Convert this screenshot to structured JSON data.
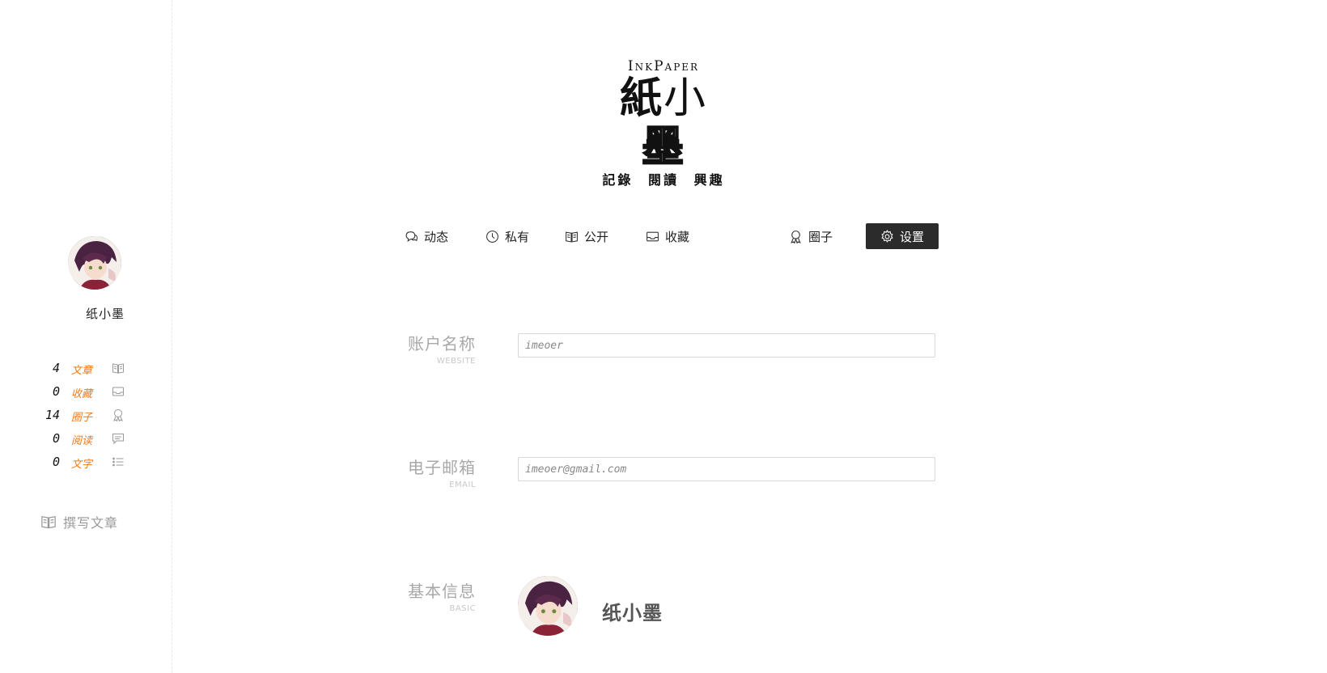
{
  "logo": {
    "en": "InkPaper",
    "cn_a": "紙",
    "cn_b": "小",
    "cn_c": "墨",
    "subtitle": "記錄 閱讀 興趣"
  },
  "sidebar": {
    "username": "纸小墨",
    "stats": [
      {
        "count": "4",
        "label": "文章",
        "icon": "book-icon"
      },
      {
        "count": "0",
        "label": "收藏",
        "icon": "inbox-icon"
      },
      {
        "count": "14",
        "label": "圈子",
        "icon": "award-icon"
      },
      {
        "count": "0",
        "label": "阅读",
        "icon": "comment-icon"
      },
      {
        "count": "0",
        "label": "文字",
        "icon": "list-icon"
      }
    ],
    "write_label": "撰写文章"
  },
  "nav": {
    "items": [
      {
        "label": "动态",
        "icon": "chat-icon"
      },
      {
        "label": "私有",
        "icon": "clock-icon"
      },
      {
        "label": "公开",
        "icon": "book-icon"
      },
      {
        "label": "收藏",
        "icon": "inbox-icon"
      },
      {
        "label": "圈子",
        "icon": "award-icon"
      },
      {
        "label": "设置",
        "icon": "gear-icon",
        "active": true
      }
    ]
  },
  "form": {
    "account": {
      "label": "账户名称",
      "sublabel": "WEBSITE",
      "placeholder": "imeoer"
    },
    "email": {
      "label": "电子邮箱",
      "sublabel": "EMAIL",
      "placeholder": "imeoer@gmail.com"
    },
    "basic": {
      "label": "基本信息",
      "sublabel": "BASIC",
      "name": "纸小墨"
    }
  },
  "colors": {
    "accent": "#f07a1a",
    "active_bg": "#2b2b2b"
  }
}
